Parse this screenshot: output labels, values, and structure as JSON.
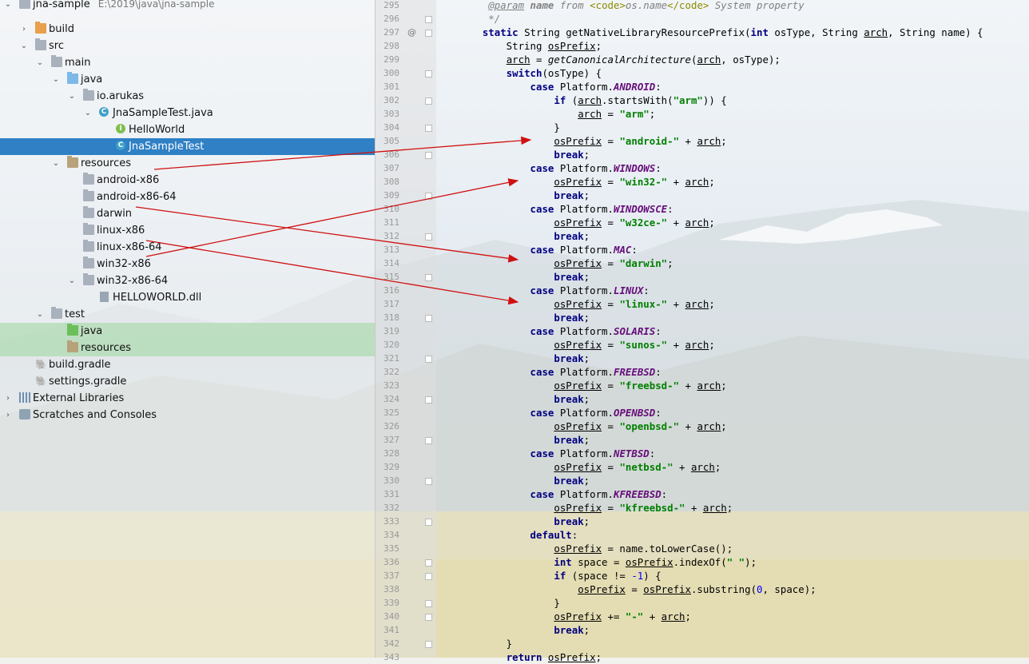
{
  "tree": {
    "project_name": "jna-sample",
    "project_path": "E:\\2019\\java\\jna-sample",
    "items": [
      {
        "label": "build"
      },
      {
        "label": "src"
      },
      {
        "label": "main"
      },
      {
        "label": "java"
      },
      {
        "label": "io.arukas"
      },
      {
        "label": "JnaSampleTest.java"
      },
      {
        "label": "HelloWorld"
      },
      {
        "label": "JnaSampleTest"
      },
      {
        "label": "resources"
      },
      {
        "label": "android-x86"
      },
      {
        "label": "android-x86-64"
      },
      {
        "label": "darwin"
      },
      {
        "label": "linux-x86"
      },
      {
        "label": "linux-x86-64"
      },
      {
        "label": "win32-x86"
      },
      {
        "label": "win32-x86-64"
      },
      {
        "label": "HELLOWORLD.dll"
      },
      {
        "label": "test"
      },
      {
        "label": "java"
      },
      {
        "label": "resources"
      },
      {
        "label": "build.gradle"
      },
      {
        "label": "settings.gradle"
      },
      {
        "label": "External Libraries"
      },
      {
        "label": "Scratches and Consoles"
      }
    ]
  },
  "editor": {
    "line_numbers": [
      "295",
      "296",
      "297",
      "298",
      "299",
      "300",
      "301",
      "302",
      "303",
      "304",
      "305",
      "306",
      "307",
      "308",
      "309",
      "310",
      "311",
      "312",
      "313",
      "314",
      "315",
      "316",
      "317",
      "318",
      "319",
      "320",
      "321",
      "322",
      "323",
      "324",
      "325",
      "326",
      "327",
      "328",
      "329",
      "330",
      "331",
      "332",
      "333",
      "334",
      "335",
      "336",
      "337",
      "338",
      "339",
      "340",
      "341",
      "342",
      "343"
    ],
    "gutter_marker": "@",
    "lines": [
      [
        {
          "t": "     "
        },
        {
          "t": "@param",
          "c": "cmt ul"
        },
        {
          "t": " name",
          "c": "cmt b"
        },
        {
          "t": " from ",
          "c": "cmt"
        },
        {
          "t": "<code>",
          "c": "tag"
        },
        {
          "t": "os.name",
          "c": "cmt"
        },
        {
          "t": "</code>",
          "c": "tag"
        },
        {
          "t": " System property",
          "c": "cmt"
        }
      ],
      [
        {
          "t": "     */",
          "c": "cmt"
        }
      ],
      [
        {
          "t": "    "
        },
        {
          "t": "static",
          "c": "kw"
        },
        {
          "t": " String getNativeLibraryResourcePrefix("
        },
        {
          "t": "int",
          "c": "kw"
        },
        {
          "t": " osType, String "
        },
        {
          "t": "arch",
          "c": "ul"
        },
        {
          "t": ", String name) {"
        }
      ],
      [
        {
          "t": "        String "
        },
        {
          "t": "osPrefix",
          "c": "ul"
        },
        {
          "t": ";"
        }
      ],
      [
        {
          "t": "        "
        },
        {
          "t": "arch",
          "c": "ul"
        },
        {
          "t": " = "
        },
        {
          "t": "getCanonicalArchitecture",
          "c": "mth"
        },
        {
          "t": "("
        },
        {
          "t": "arch",
          "c": "ul"
        },
        {
          "t": ", osType);"
        }
      ],
      [
        {
          "t": "        "
        },
        {
          "t": "switch",
          "c": "kw"
        },
        {
          "t": "(osType) {"
        }
      ],
      [
        {
          "t": "            "
        },
        {
          "t": "case",
          "c": "kw"
        },
        {
          "t": " Platform."
        },
        {
          "t": "ANDROID",
          "c": "fld"
        },
        {
          "t": ":"
        }
      ],
      [
        {
          "t": "                "
        },
        {
          "t": "if",
          "c": "kw"
        },
        {
          "t": " ("
        },
        {
          "t": "arch",
          "c": "ul"
        },
        {
          "t": ".startsWith("
        },
        {
          "t": "\"arm\"",
          "c": "str"
        },
        {
          "t": ")) {"
        }
      ],
      [
        {
          "t": "                    "
        },
        {
          "t": "arch",
          "c": "ul"
        },
        {
          "t": " = "
        },
        {
          "t": "\"arm\"",
          "c": "str"
        },
        {
          "t": ";"
        }
      ],
      [
        {
          "t": "                }"
        }
      ],
      [
        {
          "t": "                "
        },
        {
          "t": "osPrefix",
          "c": "ul"
        },
        {
          "t": " = "
        },
        {
          "t": "\"android-\"",
          "c": "str"
        },
        {
          "t": " + "
        },
        {
          "t": "arch",
          "c": "ul"
        },
        {
          "t": ";"
        }
      ],
      [
        {
          "t": "                "
        },
        {
          "t": "break",
          "c": "kw"
        },
        {
          "t": ";"
        }
      ],
      [
        {
          "t": "            "
        },
        {
          "t": "case",
          "c": "kw"
        },
        {
          "t": " Platform."
        },
        {
          "t": "WINDOWS",
          "c": "fld"
        },
        {
          "t": ":"
        }
      ],
      [
        {
          "t": "                "
        },
        {
          "t": "osPrefix",
          "c": "ul"
        },
        {
          "t": " = "
        },
        {
          "t": "\"win32-\"",
          "c": "str"
        },
        {
          "t": " + "
        },
        {
          "t": "arch",
          "c": "ul"
        },
        {
          "t": ";"
        }
      ],
      [
        {
          "t": "                "
        },
        {
          "t": "break",
          "c": "kw"
        },
        {
          "t": ";"
        }
      ],
      [
        {
          "t": "            "
        },
        {
          "t": "case",
          "c": "kw"
        },
        {
          "t": " Platform."
        },
        {
          "t": "WINDOWSCE",
          "c": "fld"
        },
        {
          "t": ":"
        }
      ],
      [
        {
          "t": "                "
        },
        {
          "t": "osPrefix",
          "c": "ul"
        },
        {
          "t": " = "
        },
        {
          "t": "\"w32ce-\"",
          "c": "str"
        },
        {
          "t": " + "
        },
        {
          "t": "arch",
          "c": "ul"
        },
        {
          "t": ";"
        }
      ],
      [
        {
          "t": "                "
        },
        {
          "t": "break",
          "c": "kw"
        },
        {
          "t": ";"
        }
      ],
      [
        {
          "t": "            "
        },
        {
          "t": "case",
          "c": "kw"
        },
        {
          "t": " Platform."
        },
        {
          "t": "MAC",
          "c": "fld"
        },
        {
          "t": ":"
        }
      ],
      [
        {
          "t": "                "
        },
        {
          "t": "osPrefix",
          "c": "ul"
        },
        {
          "t": " = "
        },
        {
          "t": "\"darwin\"",
          "c": "str"
        },
        {
          "t": ";"
        }
      ],
      [
        {
          "t": "                "
        },
        {
          "t": "break",
          "c": "kw"
        },
        {
          "t": ";"
        }
      ],
      [
        {
          "t": "            "
        },
        {
          "t": "case",
          "c": "kw"
        },
        {
          "t": " Platform."
        },
        {
          "t": "LINUX",
          "c": "fld"
        },
        {
          "t": ":"
        }
      ],
      [
        {
          "t": "                "
        },
        {
          "t": "osPrefix",
          "c": "ul"
        },
        {
          "t": " = "
        },
        {
          "t": "\"linux-\"",
          "c": "str"
        },
        {
          "t": " + "
        },
        {
          "t": "arch",
          "c": "ul"
        },
        {
          "t": ";"
        }
      ],
      [
        {
          "t": "                "
        },
        {
          "t": "break",
          "c": "kw"
        },
        {
          "t": ";"
        }
      ],
      [
        {
          "t": "            "
        },
        {
          "t": "case",
          "c": "kw"
        },
        {
          "t": " Platform."
        },
        {
          "t": "SOLARIS",
          "c": "fld"
        },
        {
          "t": ":"
        }
      ],
      [
        {
          "t": "                "
        },
        {
          "t": "osPrefix",
          "c": "ul"
        },
        {
          "t": " = "
        },
        {
          "t": "\"sunos-\"",
          "c": "str"
        },
        {
          "t": " + "
        },
        {
          "t": "arch",
          "c": "ul"
        },
        {
          "t": ";"
        }
      ],
      [
        {
          "t": "                "
        },
        {
          "t": "break",
          "c": "kw"
        },
        {
          "t": ";"
        }
      ],
      [
        {
          "t": "            "
        },
        {
          "t": "case",
          "c": "kw"
        },
        {
          "t": " Platform."
        },
        {
          "t": "FREEBSD",
          "c": "fld"
        },
        {
          "t": ":"
        }
      ],
      [
        {
          "t": "                "
        },
        {
          "t": "osPrefix",
          "c": "ul"
        },
        {
          "t": " = "
        },
        {
          "t": "\"freebsd-\"",
          "c": "str"
        },
        {
          "t": " + "
        },
        {
          "t": "arch",
          "c": "ul"
        },
        {
          "t": ";"
        }
      ],
      [
        {
          "t": "                "
        },
        {
          "t": "break",
          "c": "kw"
        },
        {
          "t": ";"
        }
      ],
      [
        {
          "t": "            "
        },
        {
          "t": "case",
          "c": "kw"
        },
        {
          "t": " Platform."
        },
        {
          "t": "OPENBSD",
          "c": "fld"
        },
        {
          "t": ":"
        }
      ],
      [
        {
          "t": "                "
        },
        {
          "t": "osPrefix",
          "c": "ul"
        },
        {
          "t": " = "
        },
        {
          "t": "\"openbsd-\"",
          "c": "str"
        },
        {
          "t": " + "
        },
        {
          "t": "arch",
          "c": "ul"
        },
        {
          "t": ";"
        }
      ],
      [
        {
          "t": "                "
        },
        {
          "t": "break",
          "c": "kw"
        },
        {
          "t": ";"
        }
      ],
      [
        {
          "t": "            "
        },
        {
          "t": "case",
          "c": "kw"
        },
        {
          "t": " Platform."
        },
        {
          "t": "NETBSD",
          "c": "fld"
        },
        {
          "t": ":"
        }
      ],
      [
        {
          "t": "                "
        },
        {
          "t": "osPrefix",
          "c": "ul"
        },
        {
          "t": " = "
        },
        {
          "t": "\"netbsd-\"",
          "c": "str"
        },
        {
          "t": " + "
        },
        {
          "t": "arch",
          "c": "ul"
        },
        {
          "t": ";"
        }
      ],
      [
        {
          "t": "                "
        },
        {
          "t": "break",
          "c": "kw"
        },
        {
          "t": ";"
        }
      ],
      [
        {
          "t": "            "
        },
        {
          "t": "case",
          "c": "kw"
        },
        {
          "t": " Platform."
        },
        {
          "t": "KFREEBSD",
          "c": "fld"
        },
        {
          "t": ":"
        }
      ],
      [
        {
          "t": "                "
        },
        {
          "t": "osPrefix",
          "c": "ul"
        },
        {
          "t": " = "
        },
        {
          "t": "\"kfreebsd-\"",
          "c": "str"
        },
        {
          "t": " + "
        },
        {
          "t": "arch",
          "c": "ul"
        },
        {
          "t": ";"
        }
      ],
      [
        {
          "t": "                "
        },
        {
          "t": "break",
          "c": "kw"
        },
        {
          "t": ";"
        }
      ],
      [
        {
          "t": "            "
        },
        {
          "t": "default",
          "c": "kw"
        },
        {
          "t": ":"
        }
      ],
      [
        {
          "t": "                "
        },
        {
          "t": "osPrefix",
          "c": "ul"
        },
        {
          "t": " = name.toLowerCase();"
        }
      ],
      [
        {
          "t": "                "
        },
        {
          "t": "int",
          "c": "kw"
        },
        {
          "t": " space = "
        },
        {
          "t": "osPrefix",
          "c": "ul"
        },
        {
          "t": ".indexOf("
        },
        {
          "t": "\" \"",
          "c": "str"
        },
        {
          "t": ");"
        }
      ],
      [
        {
          "t": "                "
        },
        {
          "t": "if",
          "c": "kw"
        },
        {
          "t": " (space != "
        },
        {
          "t": "-1",
          "c": "num"
        },
        {
          "t": ") {"
        }
      ],
      [
        {
          "t": "                    "
        },
        {
          "t": "osPrefix",
          "c": "ul"
        },
        {
          "t": " = "
        },
        {
          "t": "osPrefix",
          "c": "ul"
        },
        {
          "t": ".substring("
        },
        {
          "t": "0",
          "c": "num"
        },
        {
          "t": ", space);"
        }
      ],
      [
        {
          "t": "                }"
        }
      ],
      [
        {
          "t": "                "
        },
        {
          "t": "osPrefix",
          "c": "ul"
        },
        {
          "t": " += "
        },
        {
          "t": "\"-\"",
          "c": "str"
        },
        {
          "t": " + "
        },
        {
          "t": "arch",
          "c": "ul"
        },
        {
          "t": ";"
        }
      ],
      [
        {
          "t": "                "
        },
        {
          "t": "break",
          "c": "kw"
        },
        {
          "t": ";"
        }
      ],
      [
        {
          "t": "        }"
        }
      ],
      [
        {
          "t": "        "
        },
        {
          "t": "return",
          "c": "kw"
        },
        {
          "t": " "
        },
        {
          "t": "osPrefix",
          "c": "ul"
        },
        {
          "t": ";"
        }
      ]
    ]
  },
  "colors": {
    "selection": "#2f80c5",
    "arrow": "#d01010",
    "keyword": "#000080",
    "string": "#008000",
    "constant": "#660e7a"
  }
}
